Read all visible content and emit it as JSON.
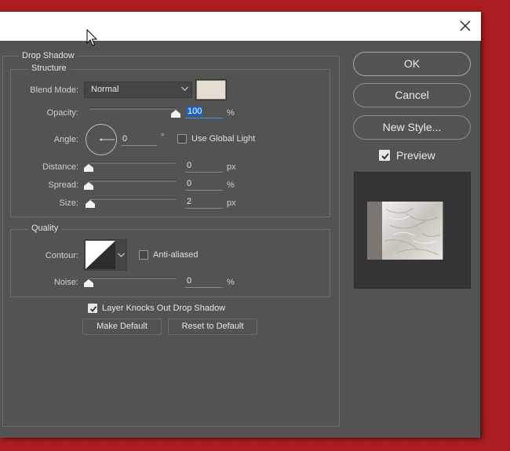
{
  "window": {
    "close_glyph": "✕"
  },
  "panel": {
    "section_title": "Drop Shadow",
    "structure": {
      "title": "Structure",
      "blend_mode_label": "Blend Mode:",
      "blend_mode_value": "Normal",
      "shadow_color": "#e5dcd2",
      "opacity_label": "Opacity:",
      "opacity_value": "100",
      "opacity_unit": "%",
      "opacity_fraction": 1.0,
      "angle_label": "Angle:",
      "angle_value": "0",
      "angle_unit": "°",
      "use_global_light_label": "Use Global Light",
      "use_global_light_checked": false,
      "distance_label": "Distance:",
      "distance_value": "0",
      "distance_unit": "px",
      "spread_label": "Spread:",
      "spread_value": "0",
      "spread_unit": "%",
      "size_label": "Size:",
      "size_value": "2",
      "size_unit": "px"
    },
    "quality": {
      "title": "Quality",
      "contour_label": "Contour:",
      "anti_aliased_label": "Anti-aliased",
      "anti_aliased_checked": false,
      "noise_label": "Noise:",
      "noise_value": "0",
      "noise_unit": "%"
    },
    "layer_knocks_label": "Layer Knocks Out Drop Shadow",
    "layer_knocks_checked": true,
    "make_default_label": "Make Default",
    "reset_default_label": "Reset to Default"
  },
  "side": {
    "ok_label": "OK",
    "cancel_label": "Cancel",
    "new_style_label": "New Style...",
    "preview_label": "Preview",
    "preview_checked": true
  },
  "colors": {
    "background": "#b01e22",
    "dialog": "#535353",
    "highlight": "#1a62c9"
  }
}
